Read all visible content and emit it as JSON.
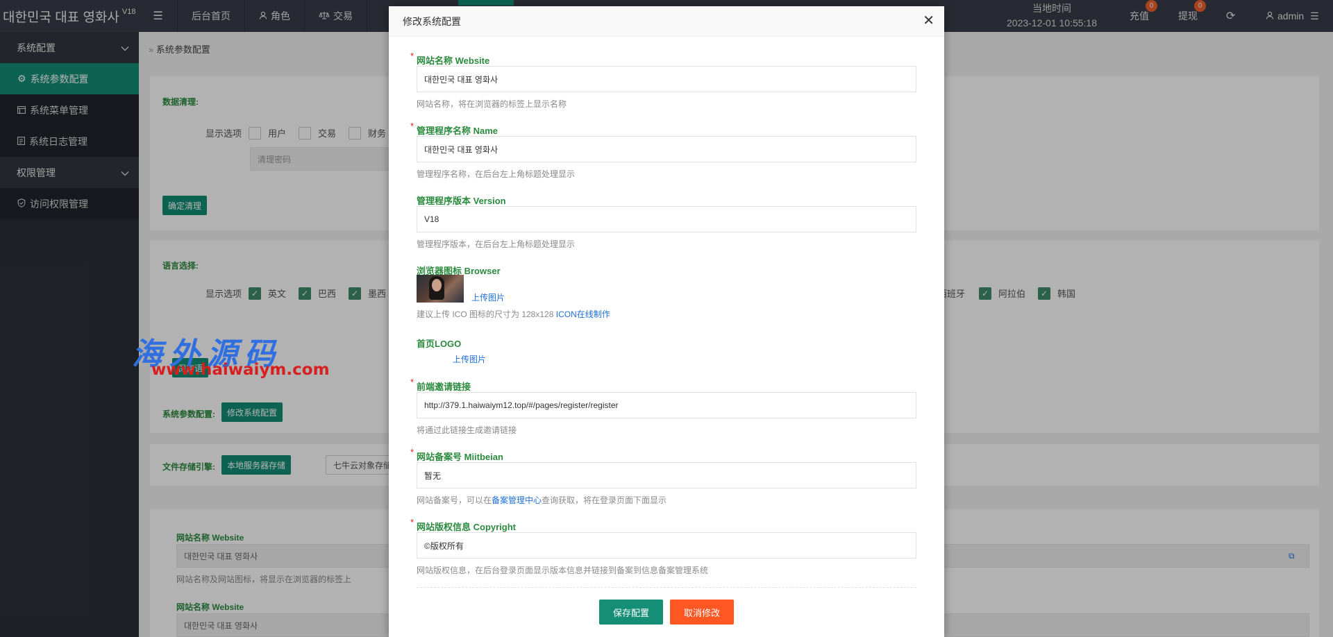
{
  "topbar": {
    "brand": "대한민국 대표 영화사",
    "version": "V18",
    "nav": [
      {
        "label": "后台首页",
        "icon": ""
      },
      {
        "label": "角色",
        "icon": "user-icon"
      },
      {
        "label": "交易",
        "icon": "scale-icon"
      }
    ],
    "time_label": "当地时间",
    "time_value": "2023-12-01 10:55:18",
    "recharge": "充值",
    "recharge_count": "0",
    "withdraw": "提现",
    "withdraw_count": "0",
    "user": "admin"
  },
  "sidebar": {
    "groups": [
      {
        "label": "系统配置",
        "items": [
          "系统参数配置",
          "系统菜单管理",
          "系统日志管理"
        ]
      },
      {
        "label": "权限管理",
        "items": [
          "访问权限管理"
        ]
      }
    ]
  },
  "main": {
    "breadcrumb": "系统参数配置",
    "data_clean": {
      "title": "数据清理:",
      "display_label": "显示选项",
      "options": [
        "用户",
        "交易",
        "财务"
      ],
      "password_placeholder": "清理密码",
      "confirm": "确定清理"
    },
    "language": {
      "title": "语言选择:",
      "display_label": "显示选项",
      "options_left": [
        "英文",
        "巴西",
        "墨西"
      ],
      "options_right": [
        "西班牙",
        "阿拉伯",
        "韩国"
      ],
      "save": "保存语"
    },
    "sys_param": {
      "title": "系统参数配置:",
      "button": "修改系统配置"
    },
    "storage": {
      "title": "文件存储引擎:",
      "local": "本地服务器存储",
      "qiniu": "七牛云对象存储"
    },
    "preview": {
      "label1": "网站名称 Website",
      "value1": "대한민국 대표 영화사",
      "hint1": "网站名称及网站图标，将显示在浏览器的标签上",
      "label2": "网站名称 Website",
      "value2": "대한민국 대표 영화사"
    }
  },
  "modal": {
    "title": "修改系统配置",
    "fields": {
      "website": {
        "label": "网站名称 Website",
        "value": "대한민국 대표 영화사",
        "tip": "网站名称，将在浏览器的标签上显示名称"
      },
      "name": {
        "label": "管理程序名称 Name",
        "value": "대한민국 대표 영화사",
        "tip": "管理程序名称，在后台左上角标题处理显示"
      },
      "version": {
        "label": "管理程序版本 Version",
        "value": "V18",
        "tip": "管理程序版本，在后台左上角标题处理显示"
      },
      "browser": {
        "label": "浏览器图标 Browser",
        "upload": "上传图片",
        "tip": "建议上传 ICO 图标的尺寸为 128x128",
        "tip_link": "ICON在线制作"
      },
      "logo": {
        "label": "首页LOGO",
        "upload": "上传图片"
      },
      "invite": {
        "label": "前端邀请链接",
        "value": "http://379.1.haiwaiym12.top/#/pages/register/register",
        "tip": "将通过此链接生成邀请链接"
      },
      "miitbeian": {
        "label": "网站备案号 Miitbeian",
        "value": "暂无",
        "tip_pre": "网站备案号，可以在",
        "tip_link": "备案管理中心",
        "tip_post": "查询获取，将在登录页面下面显示"
      },
      "copyright": {
        "label": "网站版权信息 Copyright",
        "value": "©版权所有",
        "tip": "网站版权信息，在后台登录页面显示版本信息并链接到备案到信息备案管理系统"
      }
    },
    "save": "保存配置",
    "cancel": "取消修改"
  },
  "watermark": {
    "text": "海外源码",
    "url": "www.haiwaiym.com"
  },
  "colors": {
    "topbar": "#3a3d49",
    "sidebar": "#2c2f3a",
    "accent": "#148f76",
    "danger": "#ff5722",
    "label_green": "#2b8a3e",
    "link": "#1e6fd9"
  }
}
